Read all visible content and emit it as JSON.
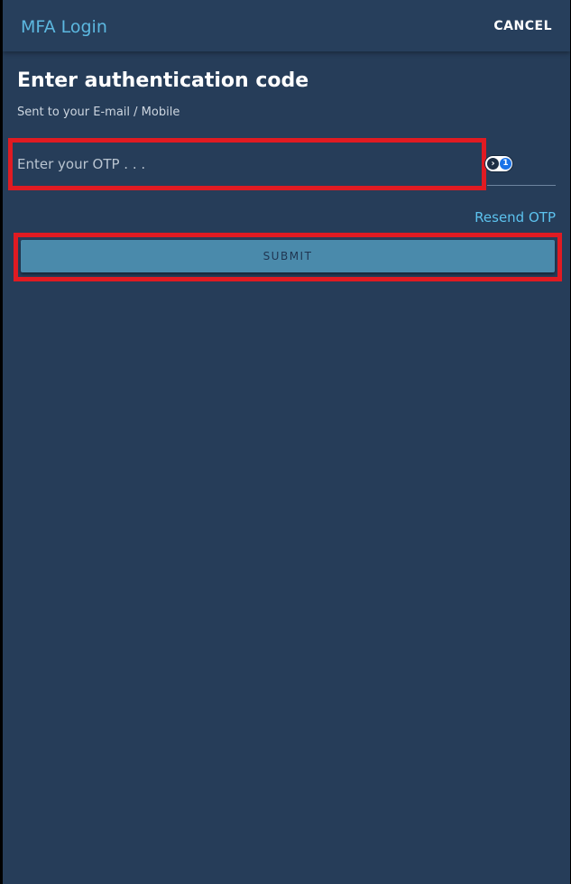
{
  "header": {
    "title": "MFA Login",
    "cancel_label": "CANCEL"
  },
  "main": {
    "heading": "Enter authentication code",
    "subtext": "Sent to your E-mail / Mobile",
    "otp": {
      "placeholder": "Enter your OTP . . .",
      "value": ""
    },
    "resend_label": "Resend OTP",
    "submit_label": "SUBMIT"
  },
  "icons": {
    "password_manager_arrow": "›",
    "password_manager_key": "1"
  },
  "colors": {
    "background": "#263d59",
    "accent": "#5cb8e0",
    "submit": "#4a8aab",
    "highlight": "#e01b22"
  }
}
